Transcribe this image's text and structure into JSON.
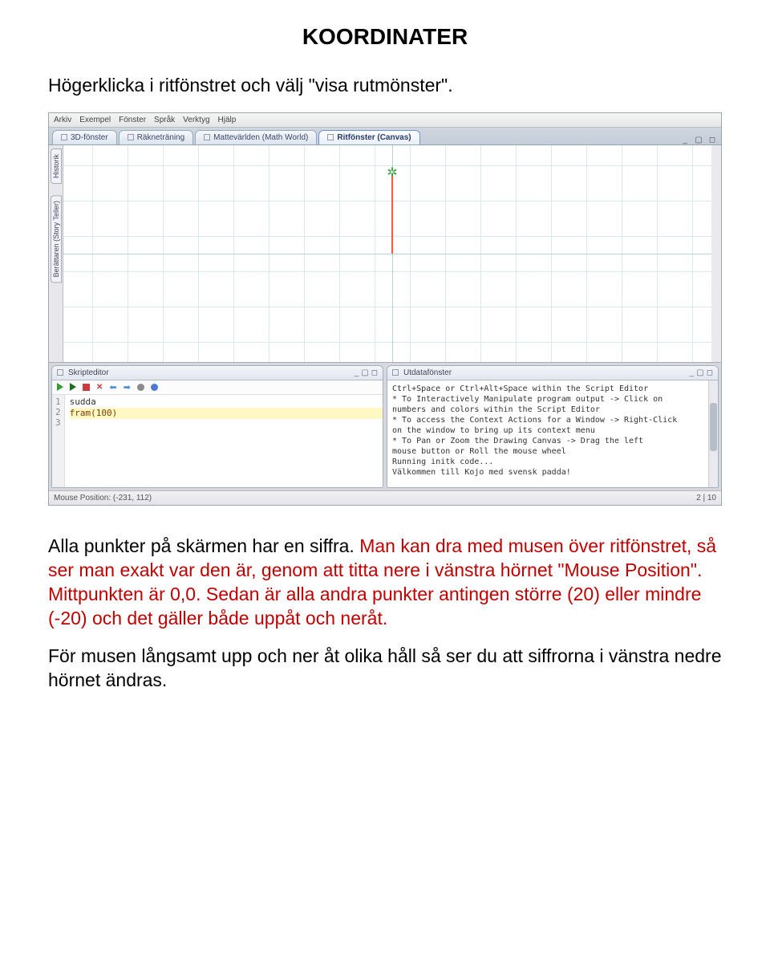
{
  "doc": {
    "title": "KOORDINATER",
    "intro": "Högerklicka i ritfönstret och välj \"visa rutmönster\".",
    "para1a": "Alla punkter på skärmen har en siffra. ",
    "para1b": "Man kan dra med musen över ritfönstret, så ser man exakt var den är, genom att titta nere i vänstra hörnet \"Mouse Position\". Mittpunkten är 0,0. Sedan är alla andra punkter antingen större (20) eller mindre (-20) och det gäller både uppåt och neråt.",
    "para2": "För musen långsamt upp och ner åt olika håll så ser du att siffrorna i vänstra nedre hörnet ändras."
  },
  "app": {
    "menu": [
      "Arkiv",
      "Exempel",
      "Fönster",
      "Språk",
      "Verktyg",
      "Hjälp"
    ],
    "tabs": [
      {
        "label": "3D-fönster"
      },
      {
        "label": "Räkneträning"
      },
      {
        "label": "Mattevärlden (Math World)"
      },
      {
        "label": "Ritfönster (Canvas)",
        "active": true
      }
    ],
    "leftTabs": [
      "Historik",
      "Berättaren (Story Teller)"
    ],
    "script": {
      "title": "Skripteditor",
      "lines": [
        {
          "n": "1",
          "text": "sudda",
          "cls": ""
        },
        {
          "n": "2",
          "text": "fram(100)",
          "cls": "hl"
        },
        {
          "n": "3",
          "text": "",
          "cls": ""
        }
      ]
    },
    "output": {
      "title": "Utdatafönster",
      "lines": [
        "Ctrl+Space or Ctrl+Alt+Space within the Script Editor",
        "* To Interactively Manipulate program output   ->  Click on",
        "numbers and colors within the Script Editor",
        "* To access the Context Actions for a Window   ->  Right-Click",
        "on the window to bring up its context menu",
        "* To Pan or Zoom the Drawing Canvas             ->  Drag the left",
        "mouse button or Roll the mouse wheel",
        "",
        "Running initk code...",
        "Välkommen till Kojo med svensk padda!"
      ]
    },
    "status": {
      "mouse": "Mouse Position: (-231, 112)",
      "cursor": "2 | 10"
    }
  }
}
